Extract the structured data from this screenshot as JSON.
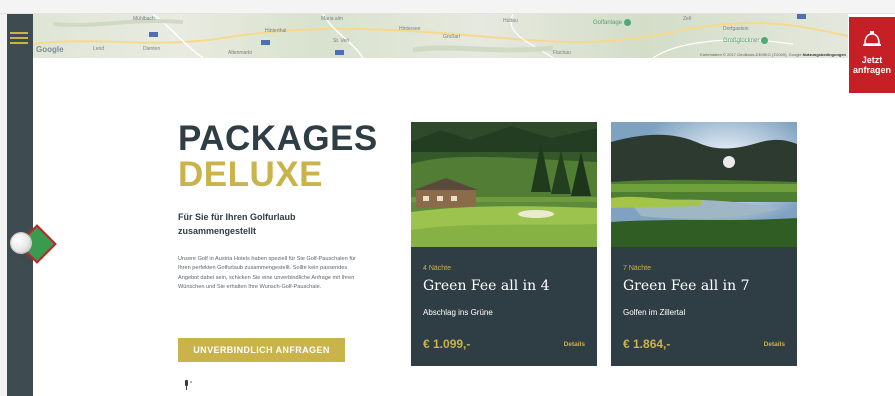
{
  "map": {
    "google": "Google",
    "labels": [
      "Mühlbach",
      "Maria alm",
      "Hinterthal",
      "Hintersee",
      "Lend",
      "Dienten",
      "St. Veit",
      "Großarl",
      "Hüttau",
      "Flachau",
      "Dorfgastein",
      "Zell",
      "Altenmarkt"
    ],
    "places": [
      {
        "name": "Golfanlage",
        "color": "#4caa74"
      },
      {
        "name": "Großglockner",
        "color": "#4caa74"
      }
    ],
    "footer": "Kartendaten © 2017 GeoBasis-DE/BKG (©2009), Google",
    "footer_link": "Nutzungsbedingungen"
  },
  "sidebar": {
    "menu_icon": "hamburger-icon"
  },
  "request_button": {
    "label_line1": "Jetzt",
    "label_line2": "anfragen",
    "icon": "bell-icon"
  },
  "golf_badge": {
    "label": "GOLF"
  },
  "hero": {
    "title_line1": "PACKAGES",
    "title_line2": "DELUXE",
    "subtitle": "Für Sie für Ihren Golfurlaub zusammengestellt",
    "body": "Unsere Golf in Austria Hotels haben speziell für Sie Golf-Pauschalen für Ihren perfekten Golfurlaub zusammengestellt. Sollte kein passendes Angebot dabei sein, schicken Sie eine unverbindliche Anfrage mit Ihren Wünschen und Sie erhalten Ihre Wunsch-Golf-Pauschale.",
    "cta": "UNVERBINDLICH ANFRAGEN"
  },
  "cards": [
    {
      "nights": "4 Nächte",
      "title": "Green Fee all in 4",
      "subtitle": "Abschlag ins Grüne",
      "price": "€ 1.099,-",
      "details": "Details"
    },
    {
      "nights": "7 Nächte",
      "title": "Green Fee all in 7",
      "subtitle": "Golfen im Zillertal",
      "price": "€ 1.864,-",
      "details": "Details"
    }
  ],
  "colors": {
    "dark": "#2f3d44",
    "gold": "#c9b34b",
    "red": "#c62026",
    "sidebar": "#3e4b51"
  }
}
